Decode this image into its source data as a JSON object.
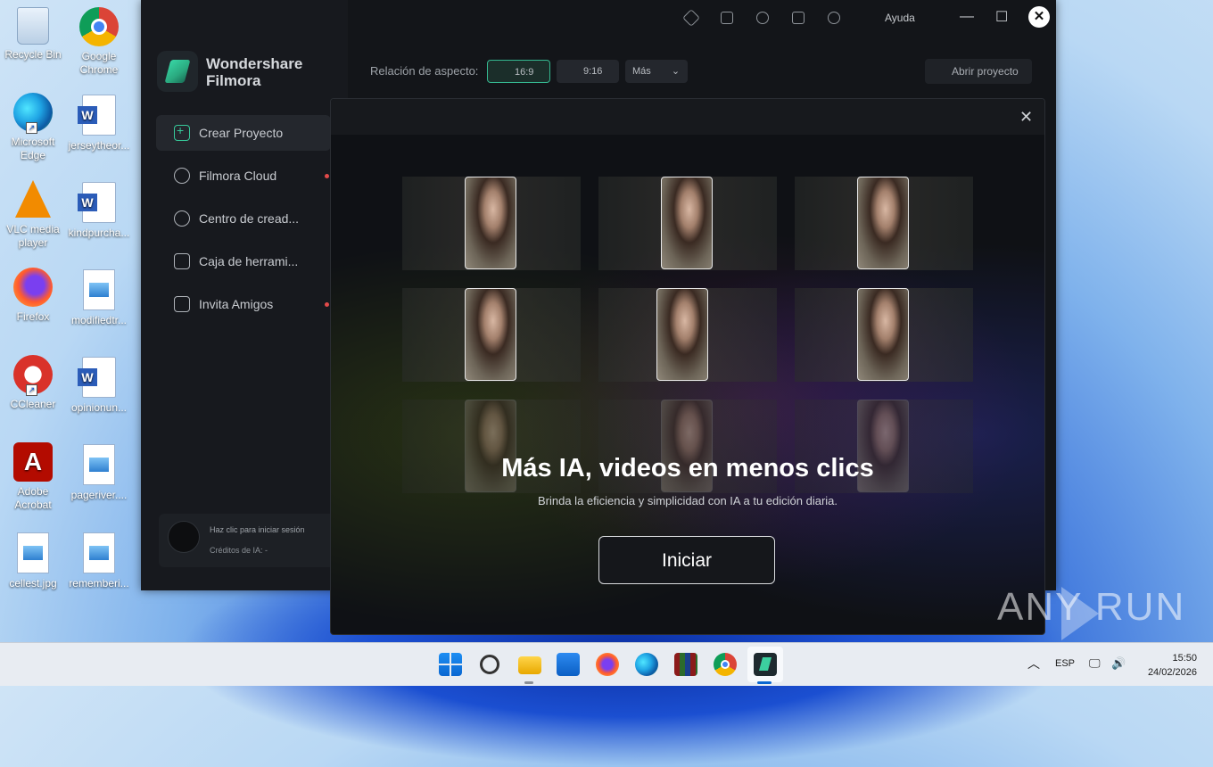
{
  "desktop": {
    "icons": [
      {
        "label": "Recycle Bin",
        "icon": "recycle-bin-icon"
      },
      {
        "label": "Google Chrome",
        "icon": "chrome-icon"
      },
      {
        "label": "Microsoft Edge",
        "icon": "edge-icon"
      },
      {
        "label": "jerseytheor...",
        "icon": "word-doc-icon"
      },
      {
        "label": "VLC media player",
        "icon": "vlc-icon"
      },
      {
        "label": "kindpurcha...",
        "icon": "word-doc-icon"
      },
      {
        "label": "Firefox",
        "icon": "firefox-icon"
      },
      {
        "label": "modifiedtr...",
        "icon": "image-file-icon"
      },
      {
        "label": "CCleaner",
        "icon": "ccleaner-icon"
      },
      {
        "label": "opinionun...",
        "icon": "word-doc-icon"
      },
      {
        "label": "Adobe Acrobat",
        "icon": "acrobat-icon"
      },
      {
        "label": "pageriver....",
        "icon": "image-file-icon"
      },
      {
        "label": "cellest.jpg",
        "icon": "image-file-icon"
      },
      {
        "label": "rememberi...",
        "icon": "image-file-icon"
      }
    ]
  },
  "filmora": {
    "brand_line1": "Wondershare",
    "brand_line2": "Filmora",
    "nav": [
      {
        "label": "Crear Proyecto",
        "active": true
      },
      {
        "label": "Filmora Cloud",
        "badge": true
      },
      {
        "label": "Centro de cread..."
      },
      {
        "label": "Caja de herrami..."
      },
      {
        "label": "Invita Amigos",
        "badge": true
      }
    ],
    "user": {
      "login_text": "Haz clic para iniciar sesión",
      "credits_text": "Créditos de IA: -"
    },
    "header": {
      "help_label": "Ayuda",
      "aspect_label": "Relación de aspecto:",
      "aspect_16_9": "16:9",
      "aspect_9_16": "9:16",
      "more_label": "Más",
      "open_project": "Abrir proyecto"
    }
  },
  "modal": {
    "headline": "Más IA, videos en menos clics",
    "subline": "Brinda la eficiencia y simplicidad con IA a tu edición diaria.",
    "cta": "Iniciar"
  },
  "watermark": "ANY RUN",
  "taskbar": {
    "apps": [
      "start-icon",
      "search-icon",
      "file-explorer-icon",
      "store-icon",
      "firefox-icon",
      "edge-icon",
      "winrar-icon",
      "chrome-icon",
      "filmora-icon"
    ],
    "language": "ESP",
    "time": "15:50",
    "date": "24/02/2026"
  }
}
